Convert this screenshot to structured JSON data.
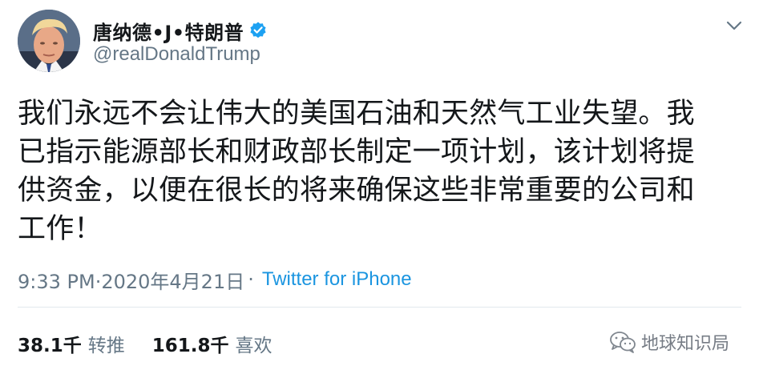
{
  "tweet": {
    "author": {
      "display_name": "唐纳德•J•特朗普",
      "handle": "@realDonaldTrump",
      "verified": true,
      "avatar_icon": "user-avatar"
    },
    "text": "我们永远不会让伟大的美国石油和天然气工业失望。我\n已指示能源部长和财政部长制定一项计划，该计划将提\n供资金，以便在很长的将来确保这些非常重要的公司和\n工作！",
    "timestamp": "9:33 PM·2020年4月21日",
    "separator": "·",
    "source": "Twitter for iPhone",
    "stats": {
      "retweets_count": "38.1千",
      "retweets_label": "转推",
      "likes_count": "161.8千",
      "likes_label": "喜欢"
    },
    "menu_icon": "chevron-down-icon"
  },
  "watermark": {
    "text": "地球知识局",
    "icon": "wechat-icon"
  },
  "colors": {
    "text_primary": "#14171a",
    "text_secondary": "#657786",
    "link": "#1b95e0",
    "verified_badge": "#1da1f2",
    "divider": "#e1e8ed"
  }
}
